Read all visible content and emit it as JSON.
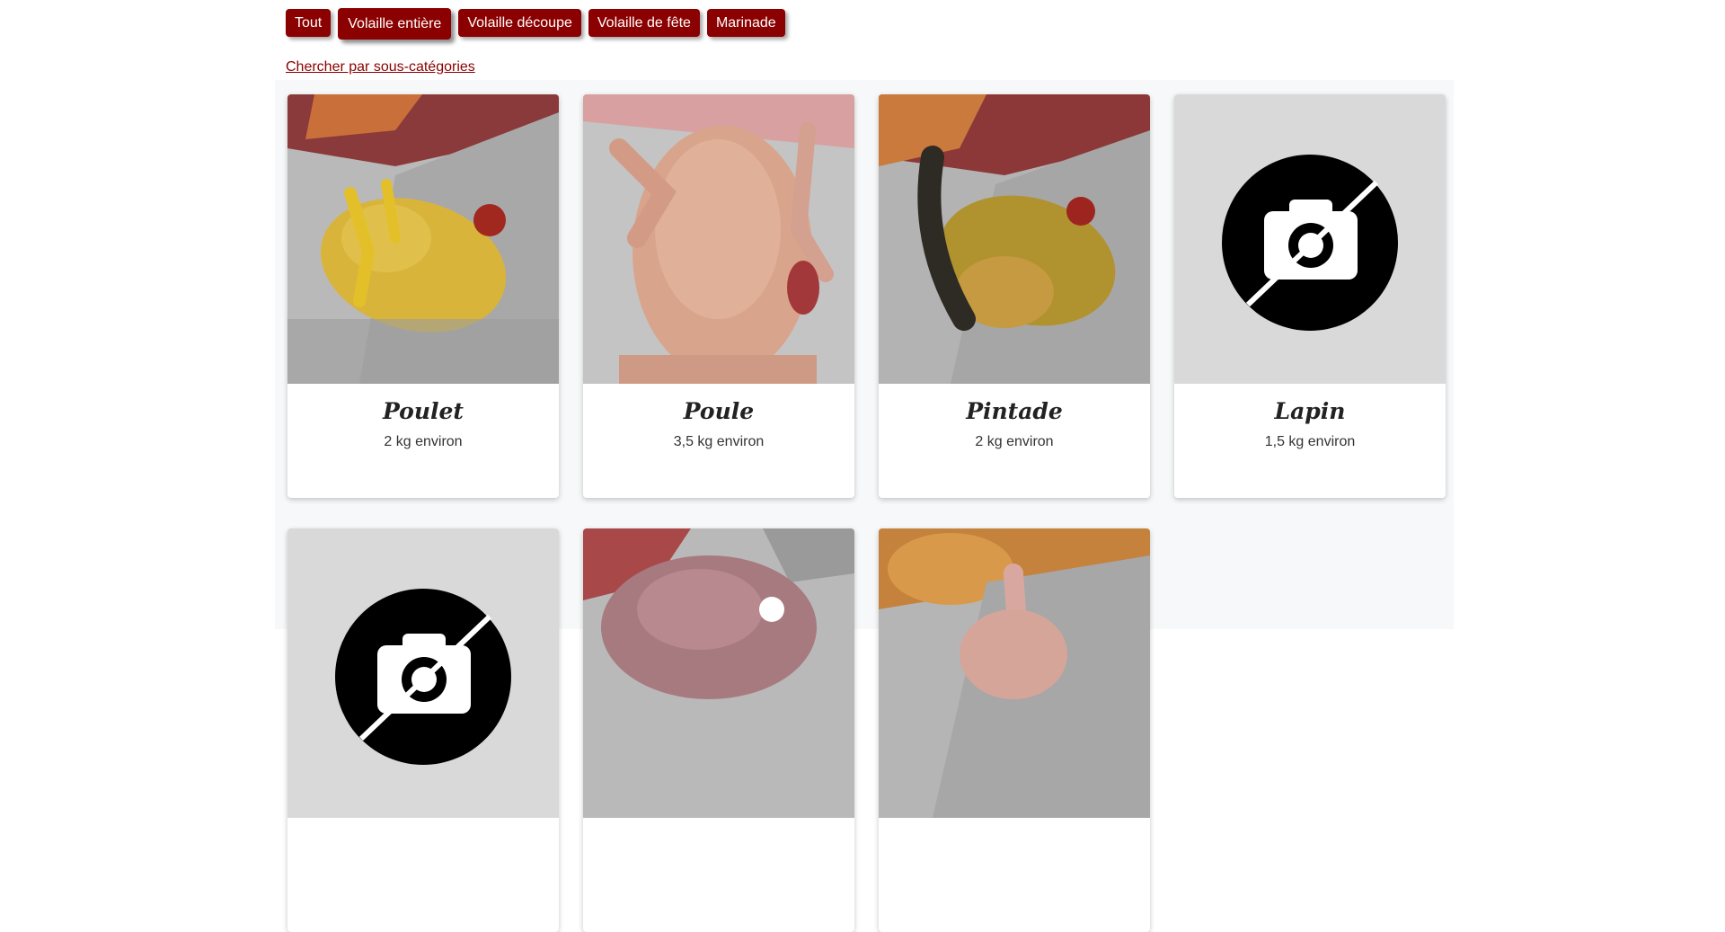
{
  "filters": [
    {
      "label": "Tout",
      "active": false
    },
    {
      "label": "Volaille entière",
      "active": true
    },
    {
      "label": "Volaille découpe",
      "active": false
    },
    {
      "label": "Volaille de fête",
      "active": false
    },
    {
      "label": "Marinade",
      "active": false
    }
  ],
  "subcategory_link": "Chercher par sous-catégories",
  "colors": {
    "accent": "#8b0000",
    "grid_bg": "#f7f8f9",
    "placeholder": "#d9d9d9"
  },
  "products": [
    {
      "name": "Poulet",
      "weight": "2 kg environ",
      "image": "photo-yellow-chicken"
    },
    {
      "name": "Poule",
      "weight": "3,5 kg environ",
      "image": "photo-hen"
    },
    {
      "name": "Pintade",
      "weight": "2 kg environ",
      "image": "photo-guinea-fowl"
    },
    {
      "name": "Lapin",
      "weight": "1,5 kg environ",
      "image": "no-photo-icon"
    },
    {
      "name": "",
      "weight": "",
      "image": "no-photo-icon"
    },
    {
      "name": "",
      "weight": "",
      "image": "photo-poultry"
    },
    {
      "name": "",
      "weight": "",
      "image": "photo-poultry"
    }
  ]
}
